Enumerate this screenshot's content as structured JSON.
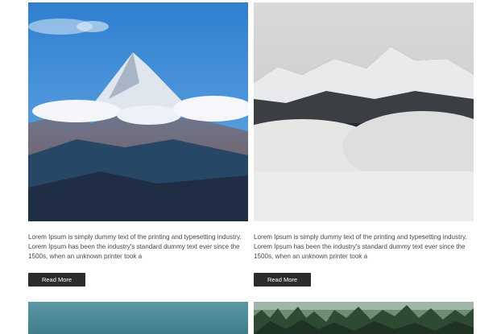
{
  "cards": [
    {
      "image": "mountain-peak-blue-sky",
      "description": "Lorem Ipsum is simply dummy text of the printing and typesetting industry. Lorem Ipsum has been the industry's standard dummy text ever since the 1500s, when an unknown printer took a",
      "button_label": "Read More"
    },
    {
      "image": "snowy-mountains-fog",
      "description": "Lorem Ipsum is simply dummy text of the printing and typesetting industry. Lorem Ipsum has been the industry's standard dummy text ever since the 1500s, when an unknown printer took a",
      "button_label": "Read More"
    }
  ],
  "bottom_images": [
    "lake-teal-water",
    "pine-forest"
  ],
  "colors": {
    "button_bg": "#2b2b2b",
    "button_text": "#ffffff",
    "body_text": "#4a4a4a"
  }
}
